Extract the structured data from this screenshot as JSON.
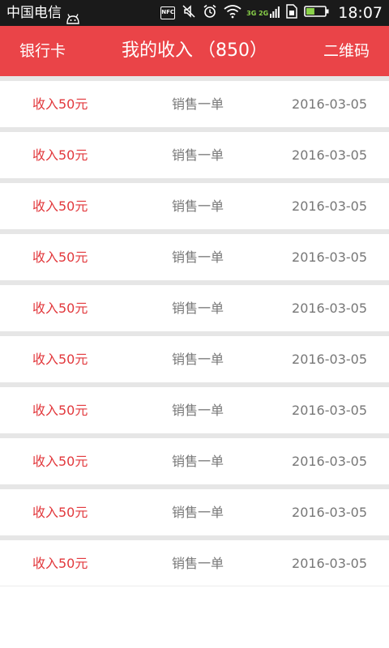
{
  "status_bar": {
    "carrier": "中国电信",
    "nfc": "NFC",
    "network_top": "3G",
    "network_bottom": "2G",
    "battery_level": 0.45,
    "time": "18:07"
  },
  "header": {
    "left_label": "银行卡",
    "title": "我的收入",
    "count_open": "（",
    "count": "850",
    "count_close": "）",
    "right_label": "二维码"
  },
  "colors": {
    "accent": "#ea4448",
    "amount_text": "#e2383c",
    "secondary_text": "#777777",
    "divider": "#e6e6e6",
    "status_bar": "#1a1a1a"
  },
  "records": [
    {
      "amount": "收入50元",
      "description": "销售一单",
      "date": "2016-03-05"
    },
    {
      "amount": "收入50元",
      "description": "销售一单",
      "date": "2016-03-05"
    },
    {
      "amount": "收入50元",
      "description": "销售一单",
      "date": "2016-03-05"
    },
    {
      "amount": "收入50元",
      "description": "销售一单",
      "date": "2016-03-05"
    },
    {
      "amount": "收入50元",
      "description": "销售一单",
      "date": "2016-03-05"
    },
    {
      "amount": "收入50元",
      "description": "销售一单",
      "date": "2016-03-05"
    },
    {
      "amount": "收入50元",
      "description": "销售一单",
      "date": "2016-03-05"
    },
    {
      "amount": "收入50元",
      "description": "销售一单",
      "date": "2016-03-05"
    },
    {
      "amount": "收入50元",
      "description": "销售一单",
      "date": "2016-03-05"
    },
    {
      "amount": "收入50元",
      "description": "销售一单",
      "date": "2016-03-05"
    }
  ]
}
